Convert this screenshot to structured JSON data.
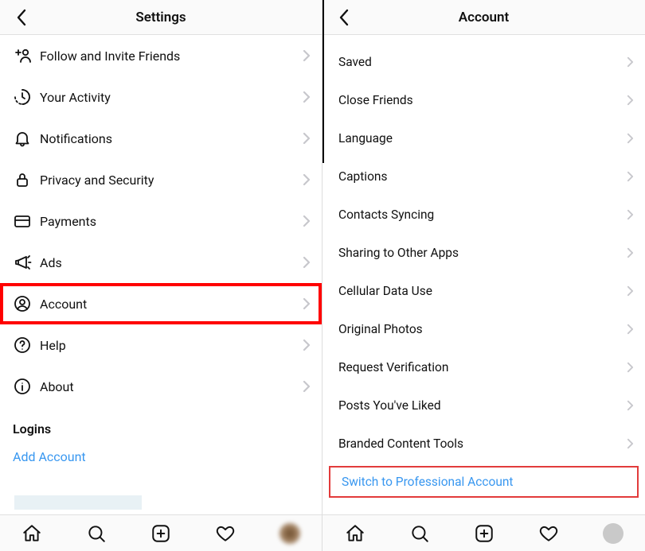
{
  "left": {
    "header_title": "Settings",
    "rows": [
      {
        "label": "Follow and Invite Friends",
        "icon": "person-plus-icon"
      },
      {
        "label": "Your Activity",
        "icon": "activity-icon"
      },
      {
        "label": "Notifications",
        "icon": "bell-icon"
      },
      {
        "label": "Privacy and Security",
        "icon": "lock-icon"
      },
      {
        "label": "Payments",
        "icon": "card-icon"
      },
      {
        "label": "Ads",
        "icon": "megaphone-icon"
      },
      {
        "label": "Account",
        "icon": "account-icon",
        "highlighted": true
      },
      {
        "label": "Help",
        "icon": "help-icon"
      },
      {
        "label": "About",
        "icon": "info-icon"
      }
    ],
    "logins_section_title": "Logins",
    "add_account_label": "Add Account"
  },
  "right": {
    "header_title": "Account",
    "rows": [
      {
        "label": "Saved"
      },
      {
        "label": "Close Friends"
      },
      {
        "label": "Language"
      },
      {
        "label": "Captions"
      },
      {
        "label": "Contacts Syncing"
      },
      {
        "label": "Sharing to Other Apps"
      },
      {
        "label": "Cellular Data Use"
      },
      {
        "label": "Original Photos"
      },
      {
        "label": "Request Verification"
      },
      {
        "label": "Posts You've Liked"
      },
      {
        "label": "Branded Content Tools"
      }
    ],
    "switch_label": "Switch to Professional Account"
  },
  "tabs": [
    "home",
    "search",
    "create",
    "activity",
    "profile"
  ]
}
